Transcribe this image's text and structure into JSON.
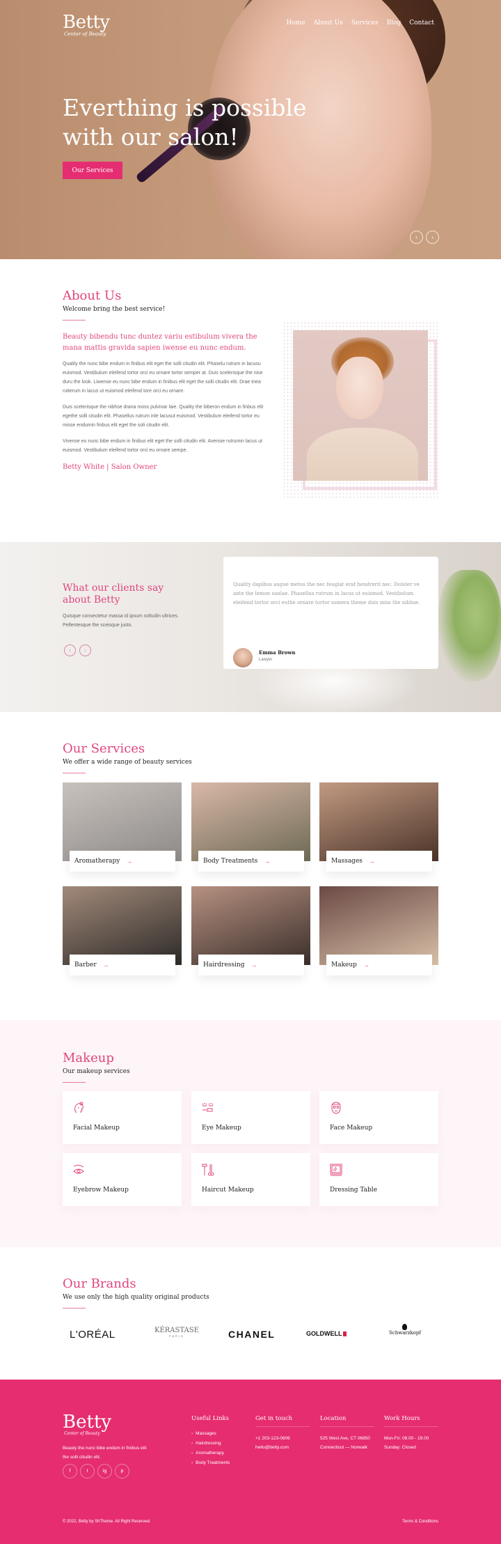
{
  "brand": {
    "name": "Betty",
    "tagline": "Center of Beauty"
  },
  "nav": [
    "Home",
    "About Us",
    "Services",
    "Blog",
    "Contact"
  ],
  "hero": {
    "headline": "Everthing is possible with our salon!",
    "cta_label": "Our Services",
    "prev_icon": "‹",
    "next_icon": "›"
  },
  "about": {
    "title": "About Us",
    "subtitle": "Welcome bring the best service!",
    "lead": "Beauty bibendu tunc duntez variu estibulum vivera the mana mattis gravida sapien iwense eu nunc endum.",
    "paragraphs": [
      "Quality the nunc bibe endum in finibus elit eget the solli citudin elit. Phaselu rutrum in lacusu euismod. Vestibulum eleifend tortor orci eu ornare tortor semper at. Duis scelerisque the nise duru the look. Liwense eu nunc bibe endum in finibus elit eget the solli citudin elit. Drae tnea rutierum in lacus ut euismod eleifend tore orci eu ornare.",
      "Duis scelerisque the nibhse drana moss pulvinar laie. Quality the biberon endum in finbus elit egethe solli citudin elit. Phasellus rutrum inle lacusut euismod. Vestibulum eleifend tortor eu misse endumin finbus elit eget the soli citudin elit.",
      "Vivense eu nunc bibe endum in finibus elit eget the solli citudin elit. Avensie rutrumin lacus ut euismod. Vestibulum eleifend tortor orci eu ornare sempe."
    ],
    "signature": "Betty White | Salon Owner"
  },
  "testimonials": {
    "title_line1": "What our clients say",
    "title_line2": "about Betty",
    "description": "Quisque consectetur massa id ipsum soltudin ultrices. Pellentesque the sceisque justo.",
    "quote": "Quality dapibus augue metus the nec feugiat erat hendrerit nec. Duister ve ante the lemon sanlae. Phasellus rutrum in lacus ut euismod. Vestibulum eleifend tortor orci euthe ornare tortor somera theme duis miss the nibhse.",
    "author_name": "Emma Brown",
    "author_role": "Lawyer",
    "prev_icon": "‹",
    "next_icon": "›"
  },
  "services": {
    "title": "Our Services",
    "subtitle": "We offer a wide range of beauty services",
    "arrow_icon": "→",
    "items": [
      {
        "label": "Aromatherapy",
        "color1": "#8e8a88",
        "color2": "#c8c2bd"
      },
      {
        "label": "Body Treatments",
        "color1": "#6d6a55",
        "color2": "#d9b8a7"
      },
      {
        "label": "Massages",
        "color1": "#4a3328",
        "color2": "#c29a82"
      },
      {
        "label": "Barber",
        "color1": "#2d2a28",
        "color2": "#a28a7a"
      },
      {
        "label": "Hairdressing",
        "color1": "#3a2e2a",
        "color2": "#b69181"
      },
      {
        "label": "Makeup",
        "color1": "#d9c0a8",
        "color2": "#6b4a45"
      }
    ]
  },
  "makeup": {
    "title": "Makeup",
    "subtitle": "Our makeup services",
    "items": [
      {
        "label": "Facial Makeup",
        "icon": "face-profile-icon"
      },
      {
        "label": "Eye Makeup",
        "icon": "eyelashes-icon"
      },
      {
        "label": "Face Makeup",
        "icon": "face-mask-icon"
      },
      {
        "label": "Eyebrow Makeup",
        "icon": "eyebrow-icon"
      },
      {
        "label": "Haircut Makeup",
        "icon": "razor-scissors-icon"
      },
      {
        "label": "Dressing Table",
        "icon": "mirror-icon"
      }
    ]
  },
  "brands": {
    "title": "Our Brands",
    "subtitle": "We use only the high quality original products",
    "logos": [
      "L'ORÉAL",
      "KÉRASTASE",
      "PARIS",
      "CHANEL",
      "GOLDWELL",
      "Schwarzkopf"
    ]
  },
  "footer": {
    "description": "Beauty the nunc bibe endum in finibus elit the solli citudin elit.",
    "social": [
      "f",
      "t",
      "ig",
      "p"
    ],
    "useful_links_title": "Useful Links",
    "useful_links": [
      "Massages",
      "Hairdressing",
      "Aromatherapy",
      "Body Treatments"
    ],
    "contact_title": "Get in touch",
    "phone": "+1 203-123-0606",
    "email": "hello@betty.com",
    "location_title": "Location",
    "address_line1": "525 West Ave, CT 06850",
    "address_line2": "Connecticut — Norwalk",
    "hours_title": "Work Hours",
    "hours_line1": "Mon-Fri: 08.00 - 19.00",
    "hours_line2": "Sunday: Closed",
    "copyright": "© 2022, Betty by ShTheme. All Right Reserved.",
    "terms": "Terms & Conditions"
  },
  "colors": {
    "accent": "#e0457e",
    "footer_bg": "#e52d6f",
    "makeup_bg": "#fdf5f7"
  }
}
